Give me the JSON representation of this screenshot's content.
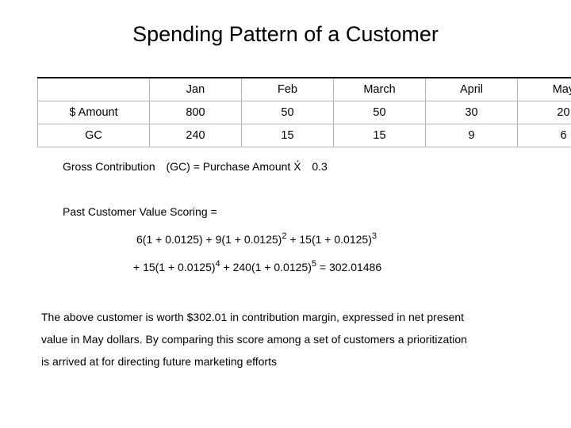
{
  "slide": {
    "title": "Spending Pattern of a Customer"
  },
  "table": {
    "corner_label": "",
    "headers": [
      "Jan",
      "Feb",
      "March",
      "April",
      "May"
    ],
    "rows": [
      {
        "label": "$ Amount",
        "values": [
          "800",
          "50",
          "50",
          "30",
          "20"
        ]
      },
      {
        "label": "GC",
        "values": [
          "240",
          "15",
          "15",
          "9",
          "6"
        ]
      }
    ]
  },
  "gc_definition": {
    "term": "Gross Contribution",
    "abbrev": "(GC)",
    "equals": "=",
    "expression": "Purchase Amount",
    "times_symbol": "X́",
    "rate": "0.3"
  },
  "past_customer_value": {
    "label": "Past Customer Value Scoring",
    "equals": "=",
    "line1": {
      "t1": "6(1 + 0.0125) + 9(1 + 0.0125)",
      "sup1": "2",
      "t2": " + 15(1 + 0.0125)",
      "sup2": "3"
    },
    "line2": {
      "t1": "+ 15(1 + 0.0125)",
      "sup1": "4",
      "t2": " + 240(1 + 0.0125)",
      "sup2": "5",
      "t3": " = 302.01486"
    }
  },
  "paragraph": {
    "line1": "The above customer is worth $302.01 in contribution margin, expressed in net present",
    "line2": "value in May dollars. By comparing this score among a set of customers a prioritization",
    "line3": "is arrived at for directing future marketing efforts"
  },
  "colors": {
    "text": "#000000",
    "background": "#ffffff",
    "table_border": "#b3b3b3",
    "table_top_border": "#000000"
  }
}
